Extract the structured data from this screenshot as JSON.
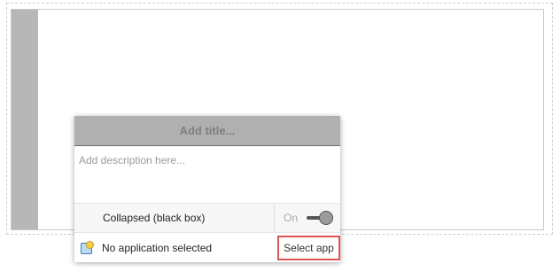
{
  "panel": {
    "title_placeholder": "Add title...",
    "description_placeholder": "Add description here...",
    "collapsed": {
      "label": "Collapsed (black box)",
      "state_label": "On",
      "enabled": true
    },
    "application": {
      "status_text": "No application selected",
      "select_button_label": "Select app",
      "icon": "application-gear-icon"
    }
  },
  "colors": {
    "lane_header": "#b7b7b7",
    "title_bar": "#b0b0b0",
    "highlight_border": "#e05252"
  }
}
